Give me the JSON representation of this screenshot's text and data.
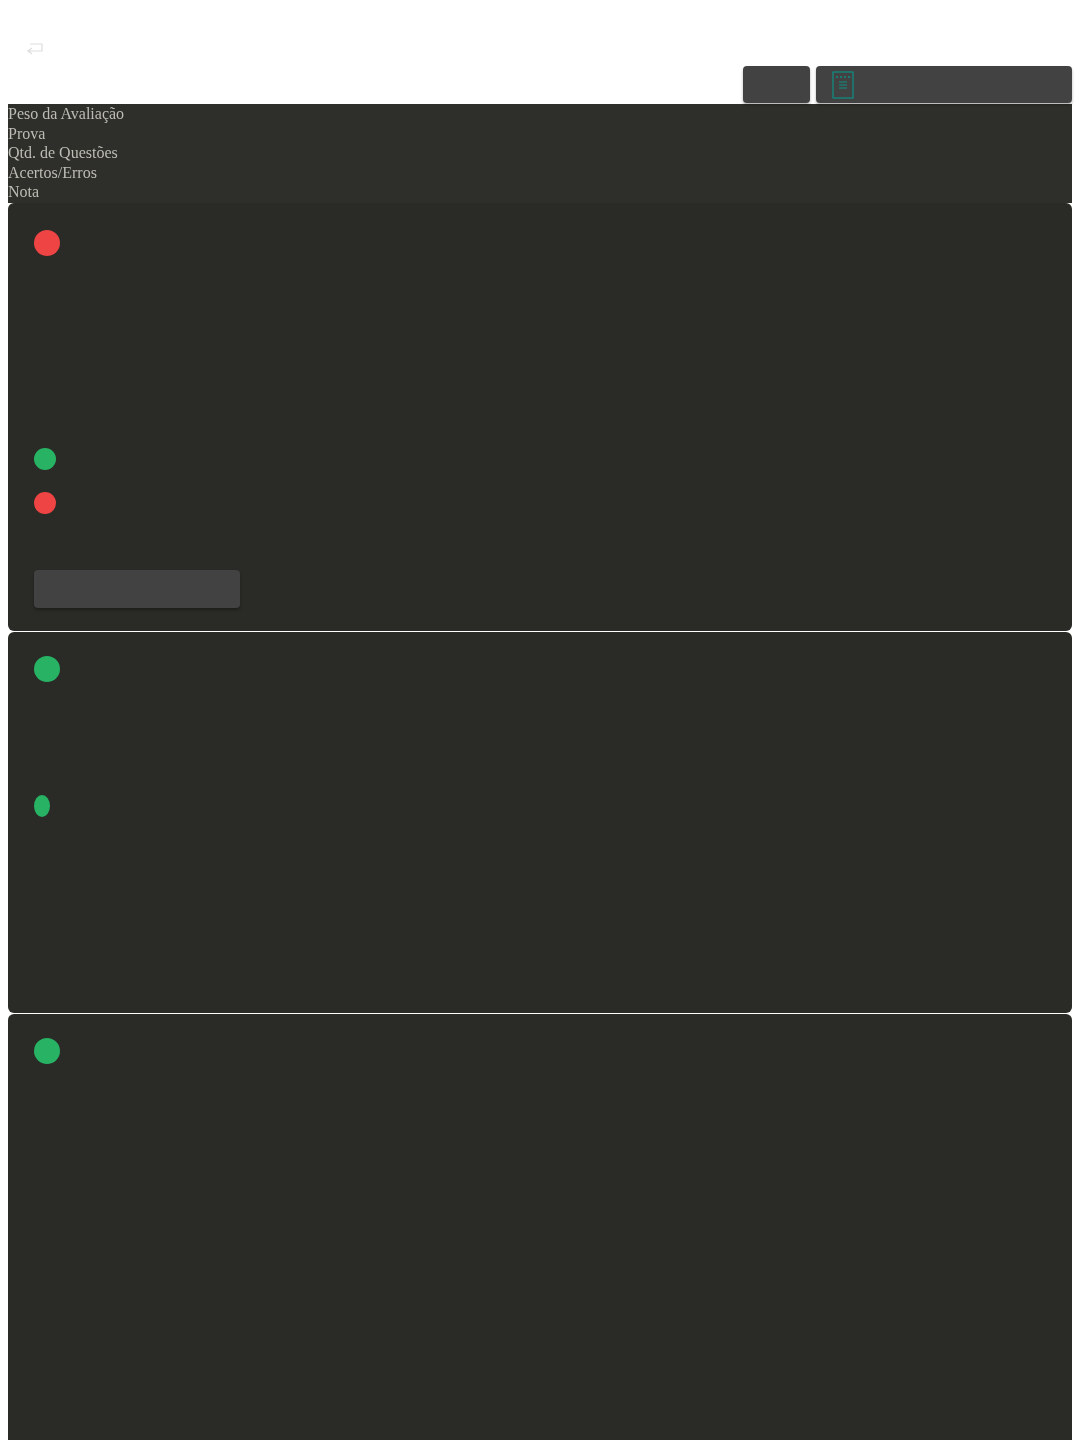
{
  "columns": [
    "Peso da Avaliação",
    "Prova",
    "Qtd. de Questões",
    "Acertos/Erros",
    "Nota"
  ],
  "cards": [
    {
      "has_button": true,
      "dots": [
        {
          "kind": "large",
          "color": "#ef4444"
        },
        {
          "kind": "small",
          "color": "#27b264"
        },
        {
          "kind": "small",
          "color": "#ef4444"
        }
      ]
    },
    {
      "has_button": false,
      "dots": [
        {
          "kind": "large",
          "color": "#27b264"
        },
        {
          "kind": "narrow",
          "color": "#27b264"
        }
      ]
    },
    {
      "has_button": false,
      "dots": [
        {
          "kind": "large",
          "color": "#27b264"
        }
      ]
    }
  ]
}
